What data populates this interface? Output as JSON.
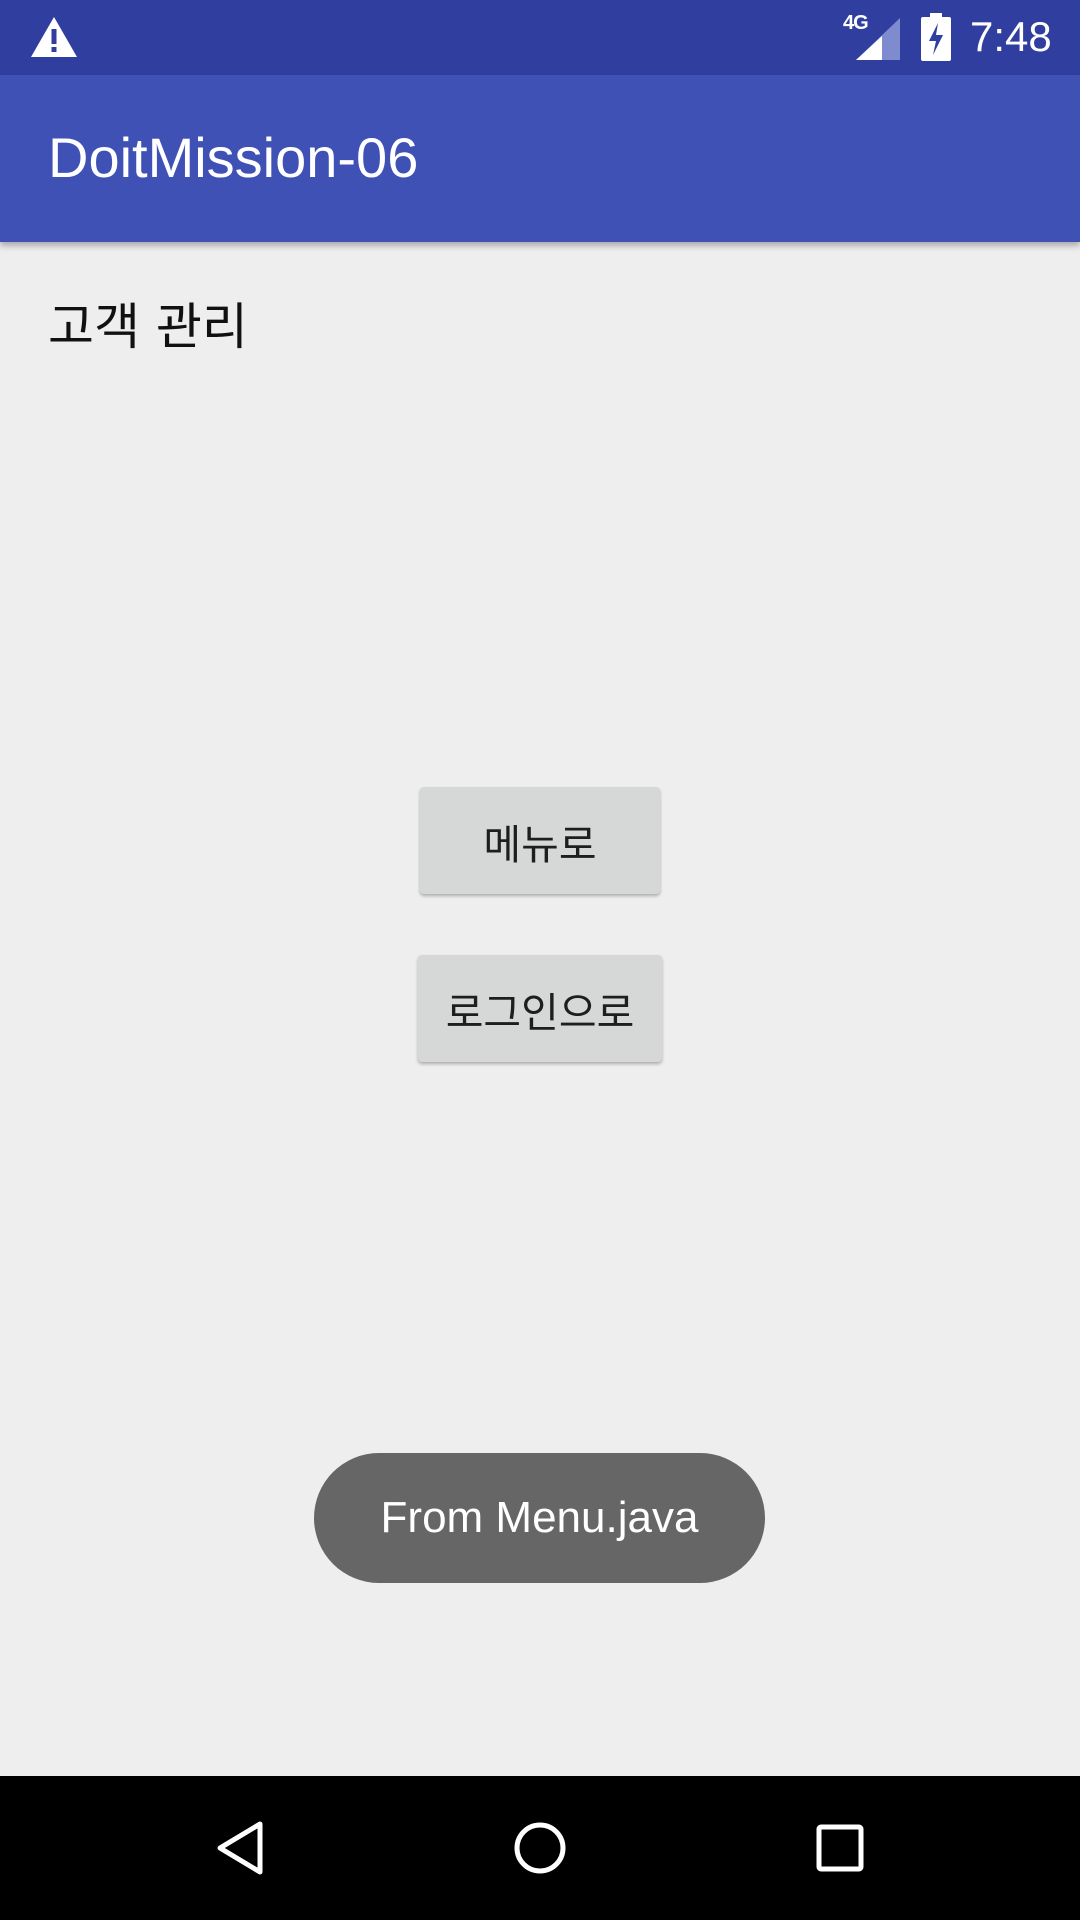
{
  "status_bar": {
    "network_label": "4G",
    "time": "7:48",
    "icons": [
      "warning-icon",
      "signal-4g-icon",
      "battery-charging-icon"
    ]
  },
  "app_bar": {
    "title": "DoitMission-06"
  },
  "content": {
    "heading": "고객 관리",
    "buttons": {
      "menu_label": "메뉴로",
      "login_label": "로그인으로"
    }
  },
  "toast": {
    "message": "From Menu.java"
  },
  "nav_bar": {
    "icons": [
      "back-icon",
      "home-icon",
      "recents-icon"
    ]
  },
  "colors": {
    "status_bar": "#303f9f",
    "app_bar": "#3f51b5",
    "background": "#eeeeee",
    "button": "#d6d7d7",
    "toast": "#666666",
    "nav_bar": "#000000"
  }
}
